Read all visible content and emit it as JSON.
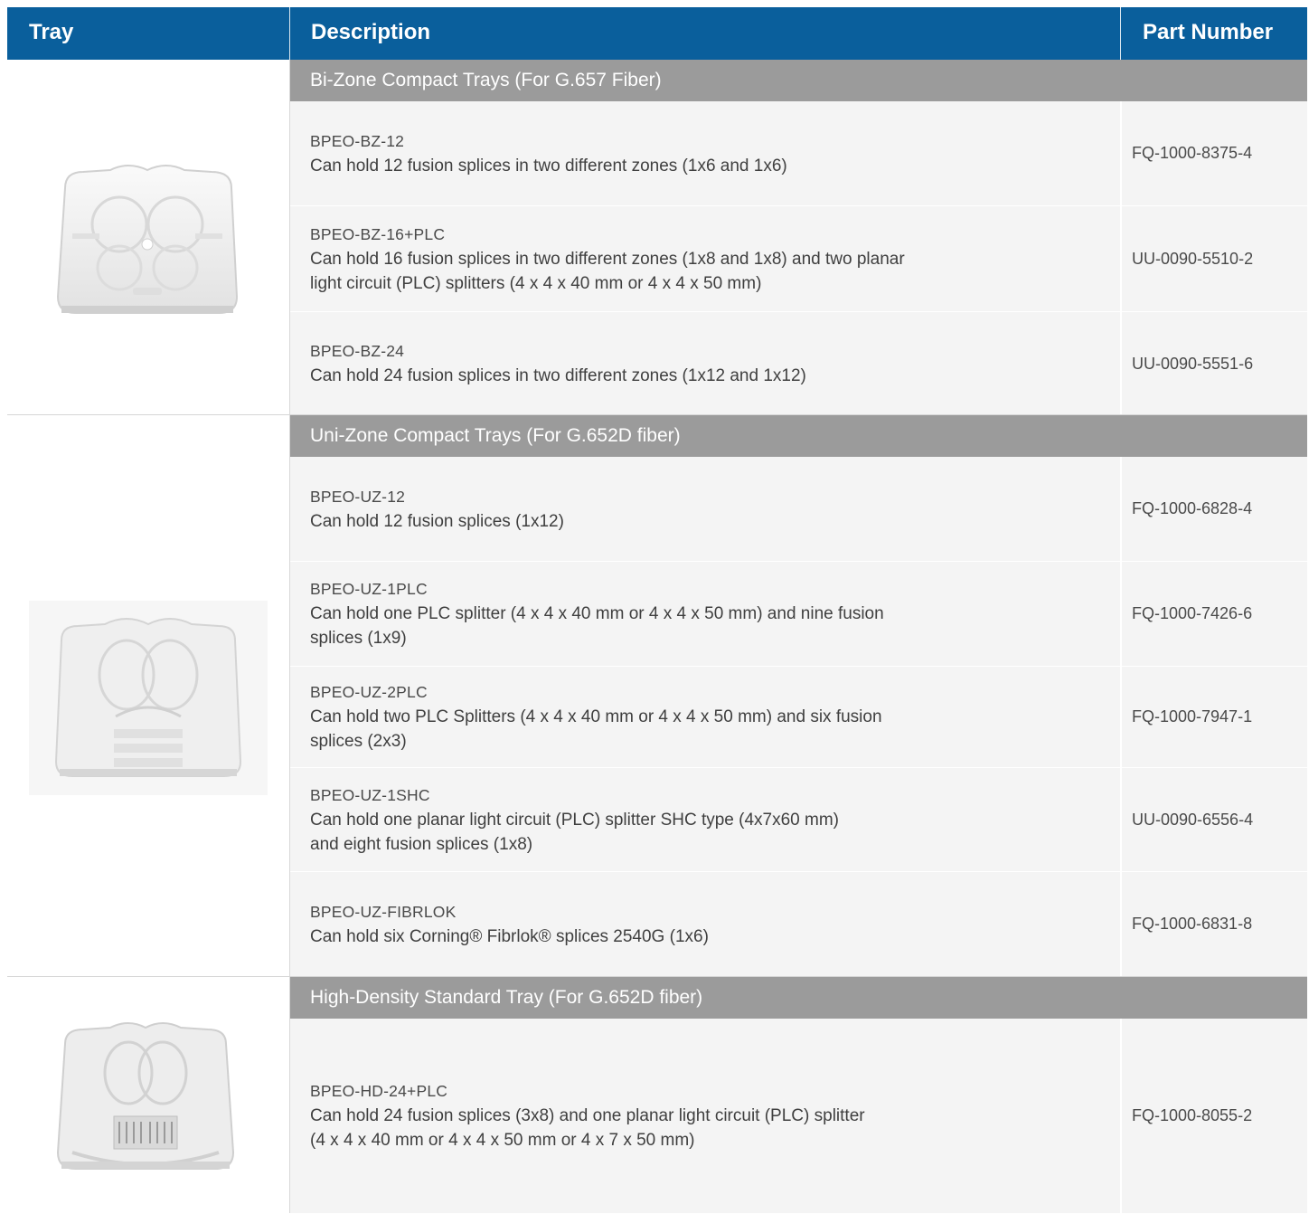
{
  "header": {
    "tray": "Tray",
    "description": "Description",
    "part_number": "Part Number"
  },
  "groups": [
    {
      "title": "Bi-Zone Compact Trays (For G.657 Fiber)",
      "image_icon": "bi-zone-tray-icon",
      "rows": [
        {
          "code": "BPEO-BZ-12",
          "lines": [
            "Can hold 12 fusion splices in two different zones (1x6 and 1x6)"
          ],
          "part": "FQ-1000-8375-4"
        },
        {
          "code": "BPEO-BZ-16+PLC",
          "lines": [
            "Can hold 16 fusion splices in two different zones (1x8 and 1x8) and two planar",
            "light circuit (PLC) splitters (4 x 4 x 40 mm or 4 x 4 x 50 mm)"
          ],
          "part": "UU-0090-5510-2"
        },
        {
          "code": "BPEO-BZ-24",
          "lines": [
            "Can hold 24 fusion splices in two different zones (1x12 and 1x12)"
          ],
          "part": "UU-0090-5551-6"
        }
      ]
    },
    {
      "title": "Uni-Zone Compact Trays (For G.652D fiber)",
      "image_icon": "uni-zone-tray-icon",
      "rows": [
        {
          "code": "BPEO-UZ-12",
          "lines": [
            "Can hold 12 fusion splices (1x12)"
          ],
          "part": "FQ-1000-6828-4"
        },
        {
          "code": "BPEO-UZ-1PLC",
          "lines": [
            "Can hold one  PLC splitter (4 x 4 x 40 mm or 4 x 4 x 50 mm) and nine fusion",
            "splices (1x9)"
          ],
          "part": "FQ-1000-7426-6"
        },
        {
          "code": "BPEO-UZ-2PLC",
          "lines": [
            "Can hold two PLC Splitters (4 x 4 x 40 mm or 4 x 4 x 50 mm) and six fusion",
            "splices (2x3)"
          ],
          "part": "FQ-1000-7947-1"
        },
        {
          "code": "BPEO-UZ-1SHC",
          "lines": [
            "Can hold one planar light circuit (PLC) splitter SHC type (4x7x60 mm)",
            "and eight fusion splices (1x8)"
          ],
          "part": "UU-0090-6556-4"
        },
        {
          "code": "BPEO-UZ-FIBRLOK",
          "lines": [
            "Can hold six Corning® Fibrlok® splices 2540G (1x6)"
          ],
          "part": "FQ-1000-6831-8"
        }
      ]
    },
    {
      "title": "High-Density Standard Tray (For G.652D fiber)",
      "image_icon": "high-density-tray-icon",
      "rows": [
        {
          "code": "BPEO-HD-24+PLC",
          "lines": [
            "Can hold 24 fusion splices (3x8) and one planar light circuit (PLC) splitter",
            "(4 x 4 x 40 mm or 4 x 4 x 50 mm or 4 x 7 x 50 mm)"
          ],
          "part": "FQ-1000-8055-2"
        }
      ]
    }
  ],
  "colors": {
    "header_bg": "#0a5f9c",
    "band_bg": "#9b9b9b",
    "row_bg": "#f4f4f4"
  }
}
